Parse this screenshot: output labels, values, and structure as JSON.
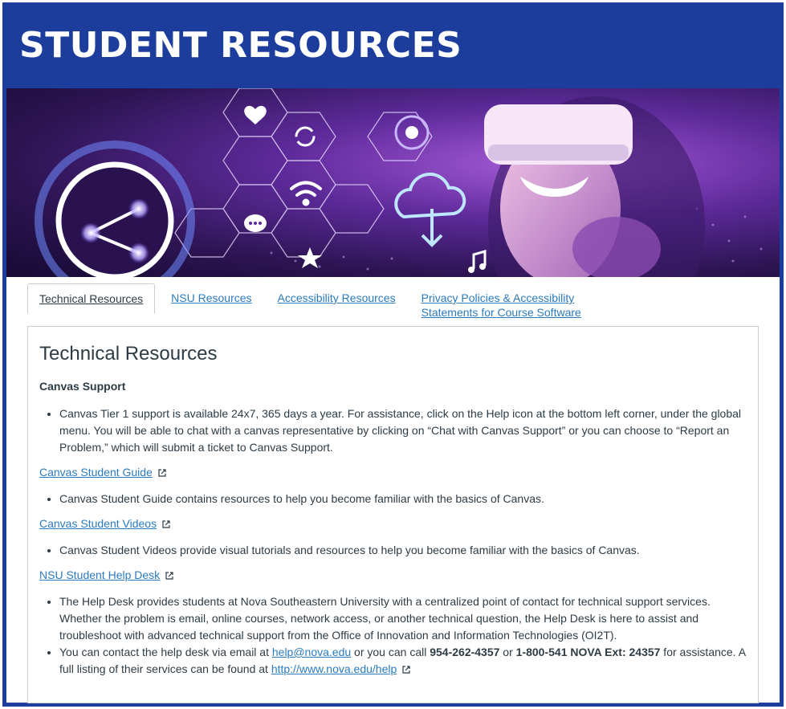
{
  "header": {
    "title": "STUDENT RESOURCES"
  },
  "colors": {
    "frame": "#1c3d9c",
    "link": "#2b7abc",
    "text": "#2d3b45"
  },
  "tabs": [
    {
      "label": "Technical Resources",
      "active": true
    },
    {
      "label": "NSU Resources",
      "active": false
    },
    {
      "label": "Accessibility Resources",
      "active": false
    },
    {
      "label": "Privacy Policies & Accessibility Statements for Course Software",
      "active": false
    }
  ],
  "panel": {
    "title": "Technical Resources",
    "canvas_support": {
      "heading": "Canvas Support",
      "bullet": "Canvas Tier 1 support is available 24x7, 365 days a year. For assistance, click on the Help icon at the bottom left corner, under the global menu. You will be able to chat with a canvas representative by clicking on “Chat with Canvas Support” or you can choose to “Report an Problem,” which will submit a ticket to Canvas Support."
    },
    "student_guide": {
      "link": "Canvas Student Guide",
      "bullet": "Canvas Student Guide contains resources to help you become familiar with the basics of Canvas."
    },
    "student_videos": {
      "link": "Canvas Student Videos",
      "bullet": "Canvas Student Videos provide visual tutorials and resources to help you become familiar with the basics of Canvas."
    },
    "help_desk": {
      "link": "NSU Student Help Desk",
      "bullet1": "The Help Desk provides students at Nova Southeastern University with a centralized point of contact for technical support services. Whether the problem is email, online courses, network access, or another technical question, the Help Desk is here to assist and troubleshoot with advanced technical support from the Office of Innovation and Information Technologies (OI2T).",
      "contact_prefix": "You can contact the help desk via email at ",
      "email": "help@nova.edu",
      "contact_mid": " or you can call ",
      "phone1": "954-262-4357",
      "or": " or ",
      "phone2": "1-800-541 NOVA Ext: 24357",
      "contact_suffix": " for assistance.  A full listing of their services can be found at ",
      "url": "http://www.nova.edu/help"
    }
  },
  "icons": [
    "share-icon",
    "heart-icon",
    "refresh-icon",
    "touch-icon",
    "wifi-icon",
    "cloud-download-icon",
    "chat-icon",
    "star-icon",
    "music-icon",
    "external-link-icon"
  ]
}
